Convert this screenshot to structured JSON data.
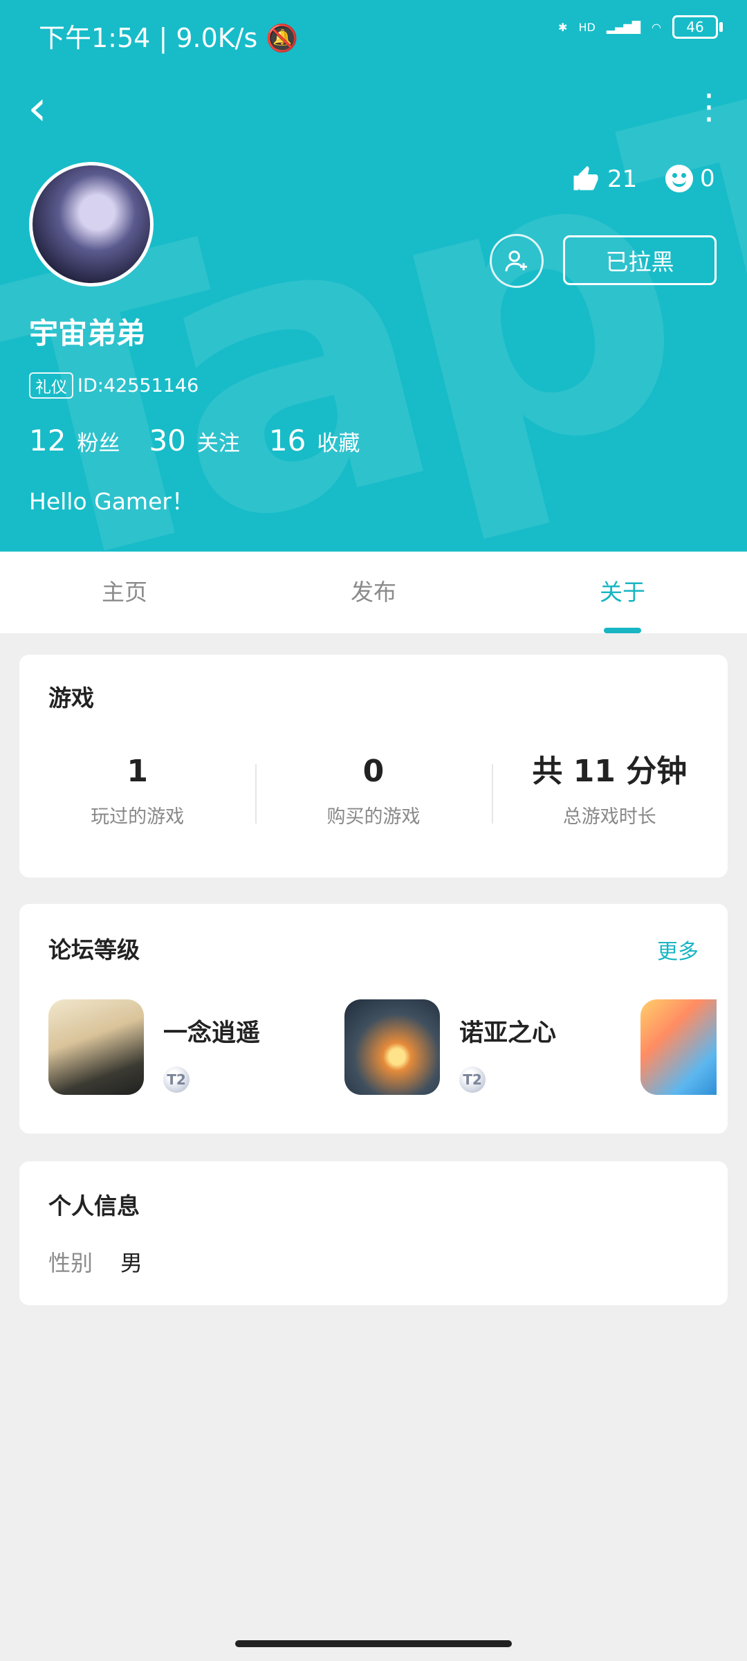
{
  "status_bar": {
    "time": "下午1:54",
    "speed": "9.0K/s",
    "network_label": "HD",
    "battery": "46"
  },
  "profile": {
    "name": "宇宙弟弟",
    "badge": "礼仪",
    "id_text": "ID:42551146",
    "likes": "21",
    "smiles": "0",
    "blacklist_label": "已拉黑",
    "stats": [
      {
        "value": "12",
        "label": "粉丝"
      },
      {
        "value": "30",
        "label": "关注"
      },
      {
        "value": "16",
        "label": "收藏"
      }
    ],
    "bio": "Hello Gamer！"
  },
  "tabs": [
    {
      "label": "主页",
      "active": false
    },
    {
      "label": "发布",
      "active": false
    },
    {
      "label": "关于",
      "active": true
    }
  ],
  "games": {
    "title": "游戏",
    "stats": [
      {
        "value": "1",
        "label": "玩过的游戏"
      },
      {
        "value": "0",
        "label": "购买的游戏"
      },
      {
        "value": "共 11 分钟",
        "label": "总游戏时长"
      }
    ]
  },
  "forum": {
    "title": "论坛等级",
    "more_label": "更多",
    "items": [
      {
        "name": "一念逍遥",
        "level": "T2"
      },
      {
        "name": "诺亚之心",
        "level": "T2"
      }
    ]
  },
  "personal": {
    "title": "个人信息",
    "gender_label": "性别",
    "gender_value": "男"
  },
  "colors": {
    "accent": "#17bcc8",
    "background": "#efefef"
  }
}
